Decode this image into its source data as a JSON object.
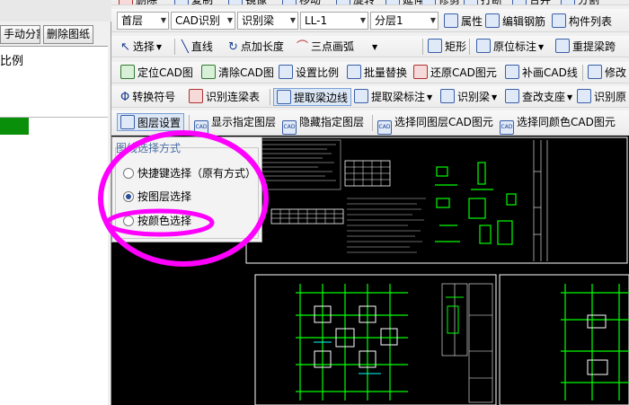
{
  "left_panel": {
    "manual_split_label": "手动分割",
    "delete_drawing_label": "删除图纸",
    "list_header_fragment": "比例"
  },
  "toolbar_row0": {
    "delete": "删除",
    "copy": "复制",
    "mirror": "镜像",
    "move": "移动",
    "rotate": "旋转",
    "extend": "延伸",
    "trim": "修剪",
    "break": "打断",
    "merge": "合并",
    "split": "分割"
  },
  "toolbar_row1": {
    "floor_value": "首层",
    "cad_recognize": "CAD识别",
    "recognize_beam": "识别梁",
    "beam_id": "LL-1",
    "layer_value": "分层1",
    "properties": "属性",
    "edit_rebar": "编辑钢筋",
    "component_list": "构件列表"
  },
  "toolbar_row2": {
    "select": "选择",
    "line": "直线",
    "point_add_length": "点加长度",
    "three_point_arc": "三点画弧",
    "rectangle": "矩形",
    "original_position_label": "原位标注",
    "re_extract_span": "重提梁跨"
  },
  "toolbar_row3": {
    "locate_cad": "定位CAD图",
    "clear_cad": "清除CAD图",
    "set_scale": "设置比例",
    "batch_replace": "批量替换",
    "restore_cad": "还原CAD图元",
    "redraw_cad_line": "补画CAD线",
    "modify": "修改"
  },
  "toolbar_row4": {
    "convert_symbol": "转换符号",
    "recognize_link_table": "识别连梁表",
    "extract_beam_edge": "提取梁边线",
    "extract_beam_label": "提取梁标注",
    "recognize_beam": "识别梁",
    "check_support": "查改支座",
    "recognize_original": "识别原"
  },
  "toolbar_row5": {
    "layer_settings": "图层设置",
    "show_layer": "显示指定图层",
    "hide_layer": "隐藏指定图层",
    "select_same_layer": "选择同图层CAD图元",
    "select_same_color": "选择同颜色CAD图元"
  },
  "icons": {
    "cad_badge": "CAD"
  },
  "dialog": {
    "title": "图线选择方式",
    "options": [
      {
        "label": "快捷键选择（原有方式）",
        "checked": false
      },
      {
        "label": "按图层选择",
        "checked": true
      },
      {
        "label": "按颜色选择",
        "checked": false
      }
    ]
  },
  "colors": {
    "annotation": "#ff00ff",
    "cad_green": "#00ff00",
    "cad_white": "#ffffff",
    "left_list_highlight": "#0a8f0a"
  }
}
